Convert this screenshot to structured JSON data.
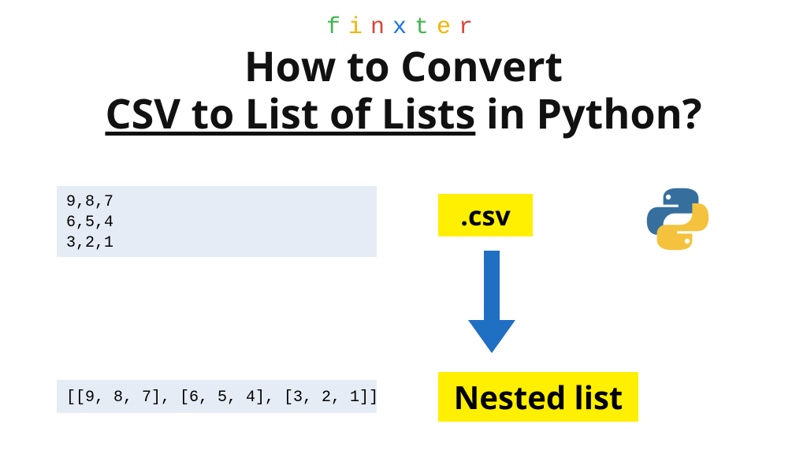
{
  "logo": {
    "letters": [
      "f",
      "i",
      "n",
      "x",
      "t",
      "e",
      "r"
    ]
  },
  "logo_colors": [
    "#3fb64f",
    "#f4b400",
    "#db4437",
    "#1a73e8",
    "#3fb64f",
    "#f4b400",
    "#db4437"
  ],
  "title": {
    "line1": "How to Convert",
    "underlined": "CSV to List of Lists",
    "line2_suffix": " in Python?"
  },
  "csv_content": "9,8,7\n6,5,4\n3,2,1",
  "list_content": "[[9, 8, 7], [6, 5, 4], [3, 2, 1]]",
  "labels": {
    "csv": ".csv",
    "nested": "Nested list"
  },
  "colors": {
    "highlight": "#ffef00",
    "arrow": "#1f6fc3",
    "codebox": "#e6ecf5"
  },
  "icons": {
    "python": "python-logo",
    "arrow": "down-arrow"
  }
}
